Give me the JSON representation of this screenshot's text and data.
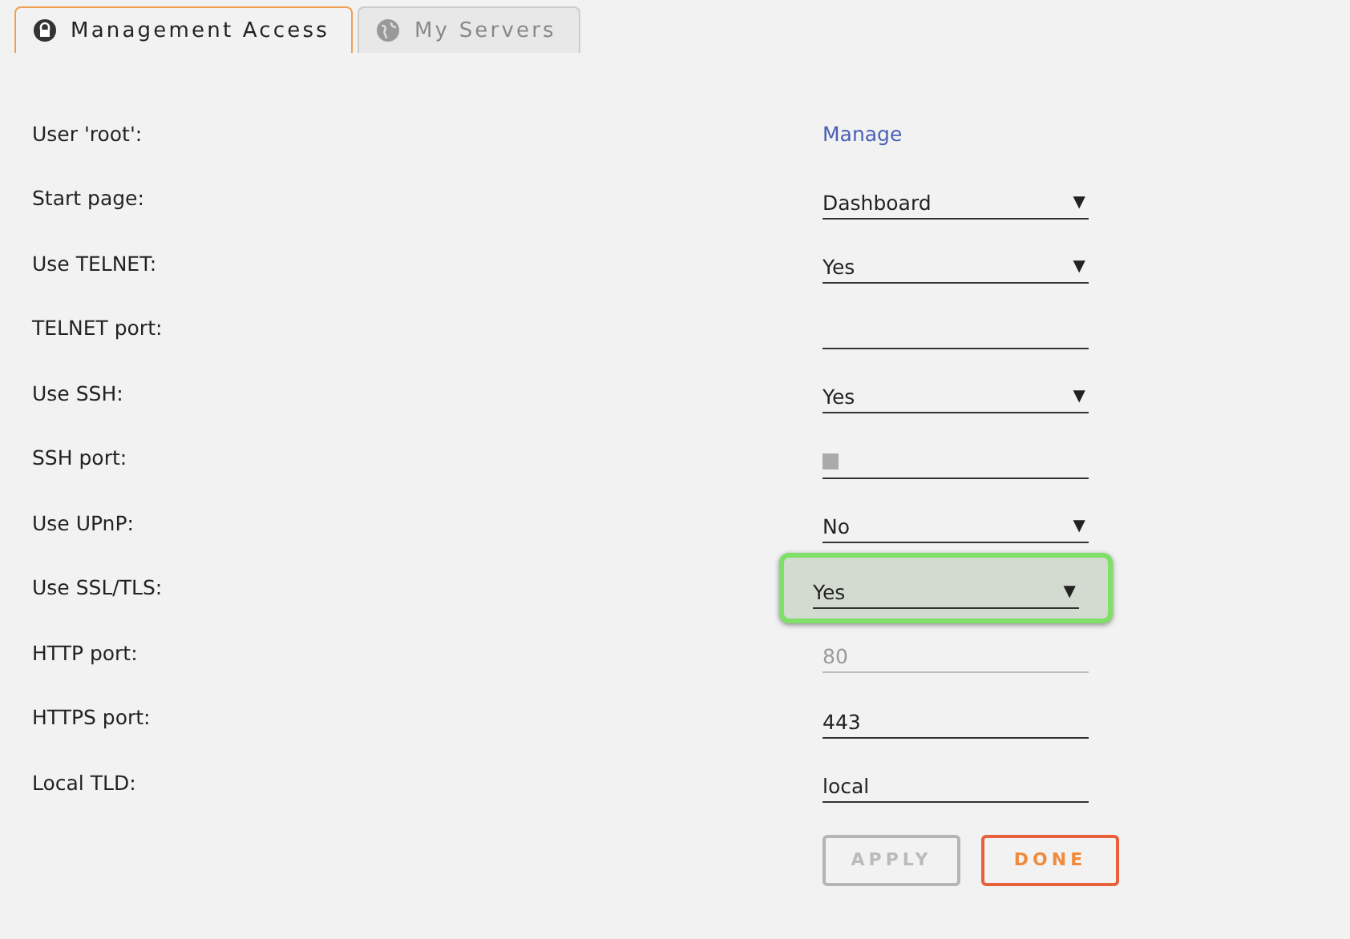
{
  "tabs": [
    {
      "label": "Management Access",
      "selected": true
    },
    {
      "label": "My Servers",
      "selected": false
    }
  ],
  "rows": [
    {
      "label": "User 'root':",
      "kind": "link",
      "value": "Manage",
      "focused": false
    },
    {
      "label": "Start page:",
      "kind": "select",
      "value": "Dashboard",
      "focused": false
    },
    {
      "label": "Use TELNET:",
      "kind": "select",
      "value": "Yes",
      "focused": false
    },
    {
      "label": "TELNET port:",
      "kind": "input",
      "focused": false,
      "disabled": false
    },
    {
      "label": "Use SSH:",
      "kind": "select",
      "value": "Yes",
      "focused": false
    },
    {
      "label": "SSH port:",
      "kind": "input",
      "marker": true,
      "focused": false,
      "disabled": false
    },
    {
      "label": "Use UPnP:",
      "kind": "select",
      "value": "No",
      "focused": false
    },
    {
      "label": "Use SSL/TLS:",
      "kind": "select",
      "value": "Yes",
      "focused": true
    },
    {
      "label": "HTTP port:",
      "kind": "input",
      "value": "80",
      "focused": false,
      "disabled": true
    },
    {
      "label": "HTTPS port:",
      "kind": "input",
      "value": "443",
      "focused": false,
      "disabled": false
    },
    {
      "label": "Local TLD:",
      "kind": "input",
      "value": "local",
      "focused": false,
      "disabled": false
    }
  ],
  "buttons": [
    {
      "label": "APPLY",
      "disabled": true
    },
    {
      "label": "DONE",
      "disabled": false
    }
  ],
  "arrow": "▼"
}
